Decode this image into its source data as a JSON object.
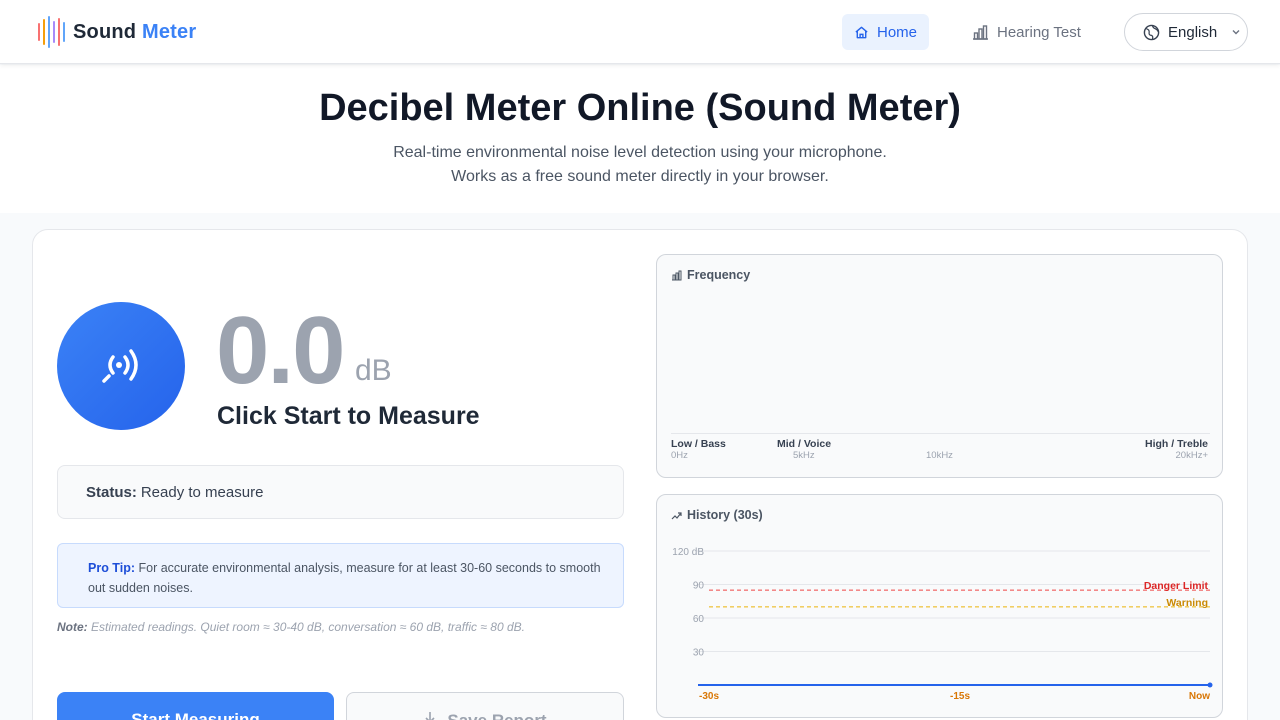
{
  "header": {
    "logo_word1": "Sound",
    "logo_word2": "Meter",
    "nav": [
      {
        "label": "Home",
        "icon": "home-icon",
        "active": true
      },
      {
        "label": "Hearing Test",
        "icon": "bar-chart-icon",
        "active": false
      }
    ],
    "language": "English"
  },
  "hero": {
    "title": "Decibel Meter Online (Sound Meter)",
    "subtitle_line1": "Real-time environmental noise level detection using your microphone.",
    "subtitle_line2": "Works as a free sound meter directly in your browser."
  },
  "meter": {
    "value": "0.0",
    "unit": "dB",
    "message": "Click Start to Measure",
    "icon": "microphone-waves-icon",
    "status_label": "Status:",
    "status_value": "Ready to measure",
    "tip_label": "Pro Tip:",
    "tip_text": "For accurate environmental analysis, measure for at least 30-60 seconds to smooth out sudden noises.",
    "note_label": "Note:",
    "note_text": "Estimated readings. Quiet room ≈ 30-40 dB, conversation ≈ 60 dB, traffic ≈ 80 dB.",
    "start_button": "Start Measuring",
    "save_button": "Save Report"
  },
  "frequency": {
    "title": "Frequency",
    "bands": [
      "Low / Bass",
      "Mid / Voice",
      "High / Treble"
    ],
    "ticks": [
      "0Hz",
      "5kHz",
      "10kHz",
      "20kHz+"
    ]
  },
  "history": {
    "title": "History (30s)",
    "y_ticks": [
      "120 dB",
      "90",
      "60",
      "30"
    ],
    "x_ticks": [
      "-30s",
      "-15s",
      "Now"
    ],
    "danger_label": "Danger Limit",
    "warning_label": "Warning"
  },
  "chart_data": {
    "type": "line",
    "title": "History (30s)",
    "x": [
      "-30s",
      "-15s",
      "Now"
    ],
    "series": [
      {
        "values": [
          0,
          0,
          0
        ]
      }
    ],
    "ylim": [
      0,
      120
    ],
    "y_ticks": [
      30,
      60,
      90,
      120
    ],
    "reference_lines": [
      {
        "label": "Danger Limit",
        "value": 85,
        "color": "#ef4444"
      },
      {
        "label": "Warning",
        "value": 70,
        "color": "#eab308"
      }
    ],
    "grid": true
  },
  "colors": {
    "accent": "#3b82f6",
    "danger": "#ef4444",
    "warning": "#eab308",
    "logo_bars": [
      "#ef4444",
      "#f59e0b",
      "#3b82f6",
      "#8b5cf6",
      "#ef4444",
      "#3b82f6",
      "#6b7280"
    ]
  }
}
